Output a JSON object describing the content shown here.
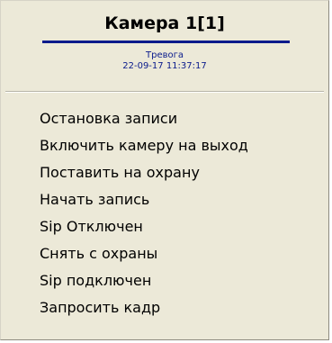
{
  "menu": {
    "title": "Камера 1[1]",
    "status": "Тревога",
    "timestamp": "22-09-17 11:37:17",
    "items": [
      {
        "label": "Остановка записи"
      },
      {
        "label": "Включить камеру на выход"
      },
      {
        "label": "Поставить на охрану"
      },
      {
        "label": "Начать запись"
      },
      {
        "label": "Sip Отключен"
      },
      {
        "label": "Снять с охраны"
      },
      {
        "label": "Sip подключен"
      },
      {
        "label": "Запросить кадр"
      }
    ]
  },
  "colors": {
    "background": "#ece9d8",
    "accent": "#0a1b8c",
    "text": "#000000"
  }
}
